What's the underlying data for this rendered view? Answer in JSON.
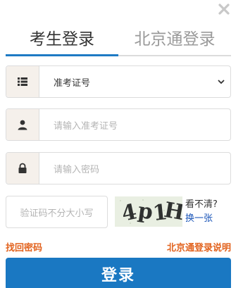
{
  "tabs": [
    {
      "label": "考生登录",
      "active": true
    },
    {
      "label": "北京通登录",
      "active": false
    }
  ],
  "form": {
    "id_type": {
      "value": "准考证号",
      "icon": "list-icon"
    },
    "id_number": {
      "placeholder": "请输入准考证号",
      "icon": "user-icon"
    },
    "password": {
      "placeholder": "请输入密码",
      "icon": "lock-icon"
    },
    "captcha": {
      "placeholder": "验证码不分大小写",
      "image_text": "4p1H",
      "unclear_label": "看不清?",
      "refresh_label": "换一张"
    }
  },
  "links": {
    "recover_password": "找回密码",
    "beijingtong_help": "北京通登录说明"
  },
  "submit_label": "登录",
  "colors": {
    "accent": "#1a78c2",
    "link_orange": "#e2621d",
    "link_blue": "#1a55b8",
    "addon_bg": "#f5f0eb"
  }
}
